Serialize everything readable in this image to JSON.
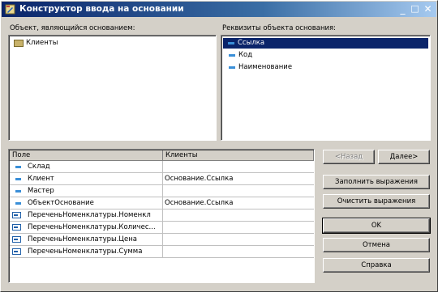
{
  "window": {
    "title": "Конструктор ввода на основании"
  },
  "left_panel": {
    "label": "Объект, являющийся основанием:",
    "items": [
      "Клиенты"
    ]
  },
  "right_panel": {
    "label": "Реквизиты объекта основания:",
    "items": [
      "Ссылка",
      "Код",
      "Наименование"
    ],
    "selected_index": 0
  },
  "grid": {
    "columns": [
      "Поле",
      "Клиенты"
    ],
    "rows": [
      {
        "field": "Склад",
        "value": ""
      },
      {
        "field": "Клиент",
        "value": "Основание.Ссылка"
      },
      {
        "field": "Мастер",
        "value": ""
      },
      {
        "field": "ОбъектОснование",
        "value": "Основание.Ссылка"
      },
      {
        "field": "ПереченьНоменклатуры.Номенкл",
        "value": ""
      },
      {
        "field": "ПереченьНоменклатуры.Количес...",
        "value": ""
      },
      {
        "field": "ПереченьНоменклатуры.Цена",
        "value": ""
      },
      {
        "field": "ПереченьНоменклатуры.Сумма",
        "value": ""
      }
    ]
  },
  "buttons": {
    "back": "<Назад",
    "next": "Далее>",
    "fill_expressions": "Заполнить выражения",
    "clear_expressions": "Очистить выражения",
    "ok": "OK",
    "cancel": "Отмена",
    "help": "Справка"
  },
  "colors": {
    "title_bar": "#0a246a",
    "selection": "#0a246a",
    "face": "#d4d0c8"
  }
}
